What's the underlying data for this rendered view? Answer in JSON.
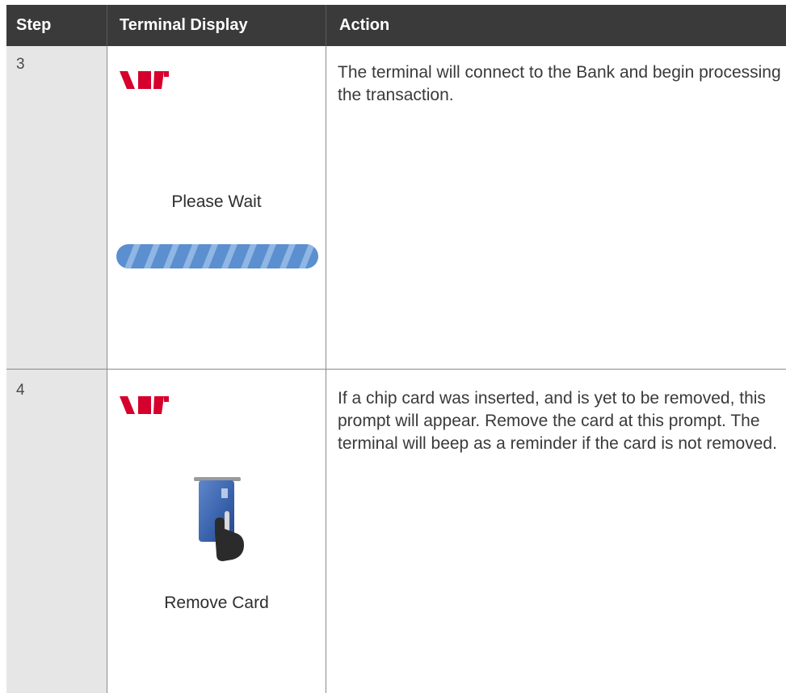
{
  "header": {
    "step": "Step",
    "terminal_display": "Terminal Display",
    "action": "Action"
  },
  "rows": [
    {
      "step": "3",
      "display_caption": "Please Wait",
      "display_icon": "progress-bar",
      "action": "The terminal will connect to the Bank and begin processing the transaction."
    },
    {
      "step": "4",
      "display_caption": "Remove Card",
      "display_icon": "remove-card-icon",
      "action": "If a chip card was inserted, and is yet to be removed, this prompt will appear. Remove the card at this prompt. The terminal will beep as a reminder if the card is not removed."
    }
  ],
  "colors": {
    "header_bg": "#3a3a3a",
    "step_column_bg": "#e6e6e6",
    "brand_red": "#d5002b",
    "progress_blue": "#5b8fcf"
  },
  "logo_icon": "westpac-logo"
}
